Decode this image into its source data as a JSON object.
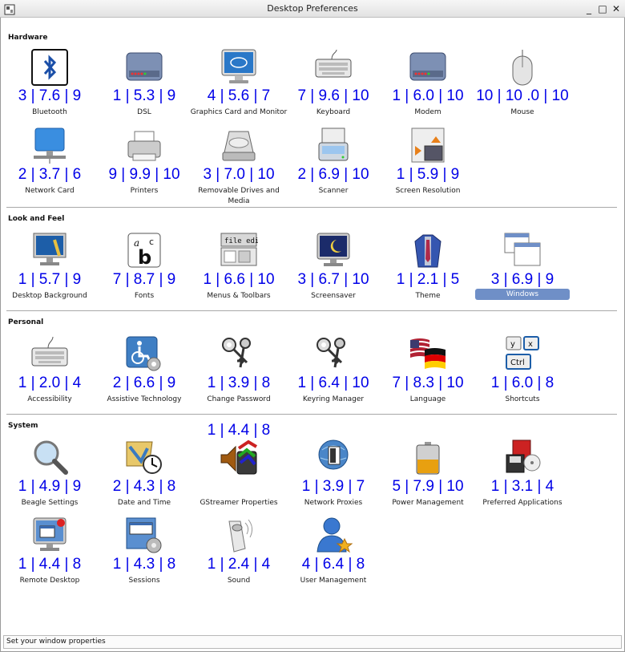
{
  "window": {
    "title": "Desktop Preferences",
    "controls": {
      "minimize": "_",
      "maximize": "□",
      "close": "✕"
    }
  },
  "sections": [
    {
      "title": "Hardware",
      "items": [
        {
          "label": "Bluetooth",
          "score": "3 | 7.6 | 9",
          "icon": "bluetooth-icon"
        },
        {
          "label": "DSL",
          "score": "1 | 5.3 | 9",
          "icon": "dsl-modem-icon"
        },
        {
          "label": "Graphics Card and Monitor",
          "score": "4 | 5.6 | 7",
          "icon": "monitor-icon"
        },
        {
          "label": "Keyboard",
          "score": "7 | 9.6 | 10",
          "icon": "keyboard-icon"
        },
        {
          "label": "Modem",
          "score": "1 | 6.0 | 10",
          "icon": "modem-icon"
        },
        {
          "label": "Mouse",
          "score": "10 | 10 .0 | 10",
          "icon": "mouse-icon"
        },
        {
          "label": "Network Card",
          "score": "2 | 3.7 | 6",
          "icon": "network-card-icon"
        },
        {
          "label": "Printers",
          "score": "9 | 9.9 | 10",
          "icon": "printer-icon"
        },
        {
          "label": "Removable Drives and Media",
          "score": "3 | 7.0 | 10",
          "icon": "removable-drive-icon"
        },
        {
          "label": "Scanner",
          "score": "2 | 6.9 | 10",
          "icon": "scanner-icon"
        },
        {
          "label": "Screen Resolution",
          "score": "1 | 5.9 | 9",
          "icon": "screen-resolution-icon"
        }
      ]
    },
    {
      "title": "Look and Feel",
      "items": [
        {
          "label": "Desktop Background",
          "score": "1 | 5.7 | 9",
          "icon": "desktop-background-icon"
        },
        {
          "label": "Fonts",
          "score": "7 | 8.7 | 9",
          "icon": "fonts-icon"
        },
        {
          "label": "Menus & Toolbars",
          "score": "1 | 6.6 | 10",
          "icon": "menus-toolbars-icon"
        },
        {
          "label": "Screensaver",
          "score": "3 | 6.7 | 10",
          "icon": "screensaver-icon"
        },
        {
          "label": "Theme",
          "score": "1 | 2.1 | 5",
          "icon": "theme-icon"
        },
        {
          "label": "Windows",
          "score": "3 | 6.9 | 9",
          "icon": "windows-icon",
          "selected": true
        }
      ]
    },
    {
      "title": "Personal",
      "items": [
        {
          "label": "Accessibility",
          "score": "1 | 2.0 | 4",
          "icon": "accessibility-keyboard-icon"
        },
        {
          "label": "Assistive Technology",
          "score": "2 | 6.6 | 9",
          "icon": "assistive-technology-icon"
        },
        {
          "label": "Change Password",
          "score": "1 | 3.9 | 8",
          "icon": "keys-icon"
        },
        {
          "label": "Keyring Manager",
          "score": "1 | 6.4 | 10",
          "icon": "keyring-icon"
        },
        {
          "label": "Language",
          "score": "7 | 8.3 | 10",
          "icon": "language-flags-icon"
        },
        {
          "label": "Shortcuts",
          "score": "1 | 6.0 | 8",
          "icon": "shortcut-keys-icon"
        }
      ]
    },
    {
      "title": "System",
      "items": [
        {
          "label": "Beagle Settings",
          "score": "1 | 4.9 | 9",
          "icon": "magnifier-icon"
        },
        {
          "label": "Date and Time",
          "score": "2 | 4.3 | 8",
          "icon": "date-time-icon"
        },
        {
          "label": "GStreamer Properties",
          "score": "1 | 4.4 | 8",
          "icon": "gstreamer-icon"
        },
        {
          "label": "Network Proxies",
          "score": "1 | 3.9 | 7",
          "icon": "network-proxy-icon"
        },
        {
          "label": "Power Management",
          "score": "5 | 7.9 | 10",
          "icon": "battery-icon"
        },
        {
          "label": "Preferred Applications",
          "score": "1 | 3.1 | 4",
          "icon": "preferred-applications-icon"
        },
        {
          "label": "Remote Desktop",
          "score": "1 | 4.4 | 8",
          "icon": "remote-desktop-icon"
        },
        {
          "label": "Sessions",
          "score": "1 | 4.3 | 8",
          "icon": "sessions-icon"
        },
        {
          "label": "Sound",
          "score": "1 | 2.4 | 4",
          "icon": "speaker-icon"
        },
        {
          "label": "User Management",
          "score": "4 | 6.4 | 8",
          "icon": "user-icon"
        }
      ]
    }
  ],
  "statusbar": {
    "text": "Set your window properties"
  },
  "colors": {
    "score": "#0000e8",
    "selection": "#6f8fc7",
    "divider": "#a8a8a8"
  }
}
